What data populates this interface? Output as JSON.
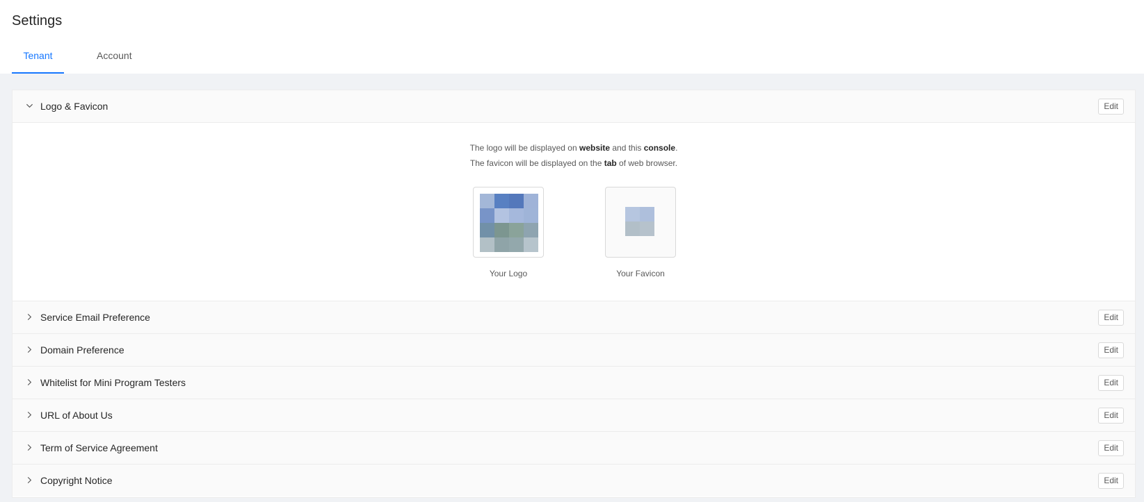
{
  "page": {
    "title": "Settings"
  },
  "tabs": [
    {
      "label": "Tenant",
      "active": true
    },
    {
      "label": "Account",
      "active": false
    }
  ],
  "sections": {
    "logo": {
      "title": "Logo & Favicon",
      "edit_label": "Edit",
      "expanded": true,
      "desc1": {
        "a": "The logo will be displayed on ",
        "b": "website",
        "c": " and this ",
        "d": "console",
        "e": "."
      },
      "desc2": {
        "a": "The favicon will be displayed on the ",
        "b": "tab",
        "c": " of web browser."
      },
      "logo_label": "Your Logo",
      "favicon_label": "Your Favicon",
      "logo_colors": [
        "#a3b7d8",
        "#5880c2",
        "#5478bb",
        "#9fb3d8",
        "#7894c8",
        "#b3c3e1",
        "#a5b8dc",
        "#9fb4d8",
        "#7190a8",
        "#7c9690",
        "#8aa39a",
        "#8ea4b0",
        "#b2c0c6",
        "#8fa4a8",
        "#93a8ac",
        "#b6c4cc"
      ],
      "favicon_colors": [
        "#b6c6e0",
        "#aebfdc",
        "#b2bfc8",
        "#b6c2cc"
      ]
    },
    "collapsed": [
      {
        "title": "Service Email Preference",
        "edit_label": "Edit"
      },
      {
        "title": "Domain Preference",
        "edit_label": "Edit"
      },
      {
        "title": "Whitelist for Mini Program Testers",
        "edit_label": "Edit"
      },
      {
        "title": "URL of About Us",
        "edit_label": "Edit"
      },
      {
        "title": "Term of Service Agreement",
        "edit_label": "Edit"
      },
      {
        "title": "Copyright Notice",
        "edit_label": "Edit"
      }
    ]
  },
  "colors": {
    "accent": "#1677ff",
    "background": "#f0f2f5"
  }
}
